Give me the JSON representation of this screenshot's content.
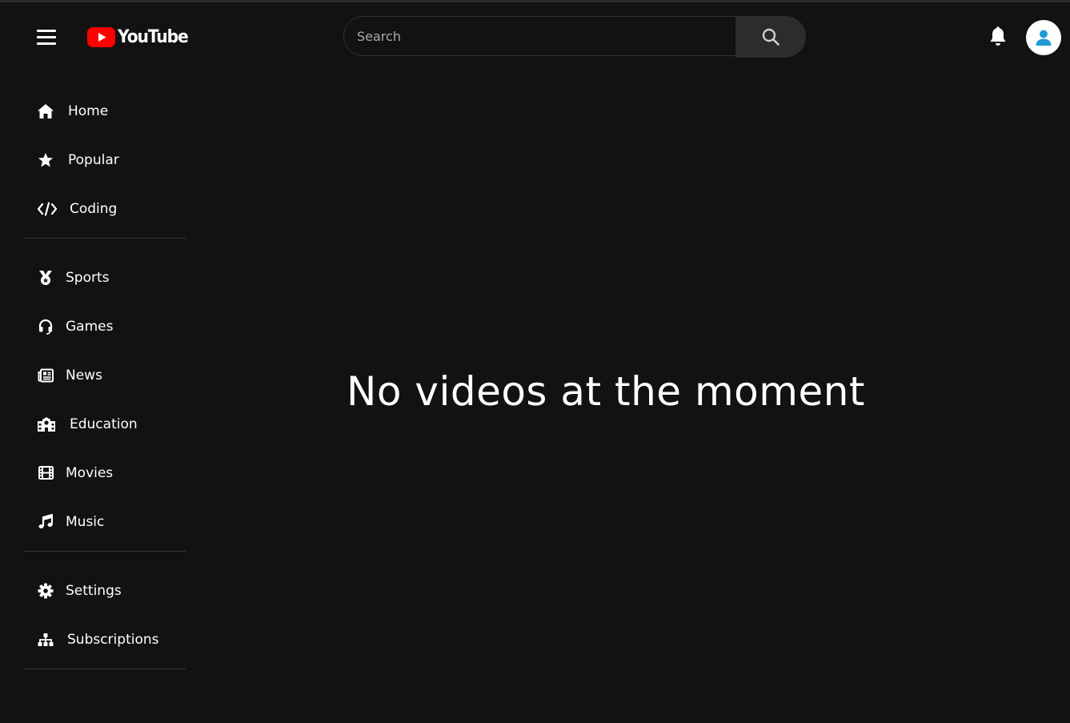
{
  "header": {
    "logo_text": "YouTube",
    "search": {
      "placeholder": "Search",
      "value": ""
    },
    "icons": {
      "menu": "hamburger-menu-icon",
      "search": "search-icon",
      "notifications": "bell-icon",
      "account": "user-icon"
    }
  },
  "sidebar": {
    "sections": [
      {
        "items": [
          {
            "label": "Home",
            "icon": "home-icon"
          },
          {
            "label": "Popular",
            "icon": "star-icon"
          },
          {
            "label": "Coding",
            "icon": "code-icon"
          }
        ]
      },
      {
        "items": [
          {
            "label": "Sports",
            "icon": "medal-icon"
          },
          {
            "label": "Games",
            "icon": "headset-icon"
          },
          {
            "label": "News",
            "icon": "newspaper-icon"
          },
          {
            "label": "Education",
            "icon": "school-icon"
          },
          {
            "label": "Movies",
            "icon": "film-icon"
          },
          {
            "label": "Music",
            "icon": "music-note-icon"
          }
        ]
      },
      {
        "items": [
          {
            "label": "Settings",
            "icon": "gear-icon"
          },
          {
            "label": "Subscriptions",
            "icon": "sitemap-icon"
          }
        ]
      }
    ]
  },
  "main": {
    "empty_message": "No videos at the moment"
  },
  "colors": {
    "background": "#121212",
    "brand_red": "#ff0000",
    "search_button": "#2c2c2c",
    "avatar_icon": "#1e9bd7"
  }
}
